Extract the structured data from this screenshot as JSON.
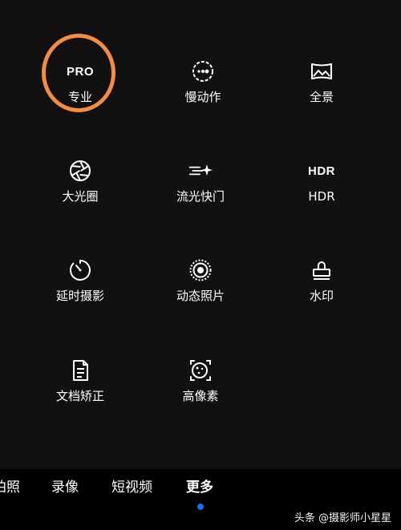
{
  "modes": [
    {
      "id": "pro",
      "icon": "pro-text-icon",
      "icon_text": "PRO",
      "label": "专业"
    },
    {
      "id": "slowmo",
      "icon": "slow-motion-icon",
      "label": "慢动作"
    },
    {
      "id": "panorama",
      "icon": "panorama-icon",
      "label": "全景"
    },
    {
      "id": "aperture",
      "icon": "aperture-icon",
      "label": "大光圈"
    },
    {
      "id": "lighttrail",
      "icon": "light-trail-icon",
      "label": "流光快门"
    },
    {
      "id": "hdr",
      "icon": "hdr-text-icon",
      "icon_text": "HDR",
      "label": "HDR"
    },
    {
      "id": "timelapse",
      "icon": "timelapse-icon",
      "label": "延时摄影"
    },
    {
      "id": "livephoto",
      "icon": "live-photo-icon",
      "label": "动态照片"
    },
    {
      "id": "watermark",
      "icon": "stamp-icon",
      "label": "水印"
    },
    {
      "id": "document",
      "icon": "document-icon",
      "label": "文档矫正"
    },
    {
      "id": "highres",
      "icon": "high-resolution-icon",
      "label": "高像素"
    }
  ],
  "bottom_tabs": [
    {
      "label": "拍照"
    },
    {
      "label": "录像"
    },
    {
      "label": "短视频"
    },
    {
      "label": "更多",
      "active": true
    }
  ],
  "watermark_text": "头条 @摄影师小星星",
  "colors": {
    "background": "#121011",
    "bottom_bar": "#000000",
    "highlight_ring": "#f18d44",
    "active_indicator": "#1d6ff2"
  }
}
